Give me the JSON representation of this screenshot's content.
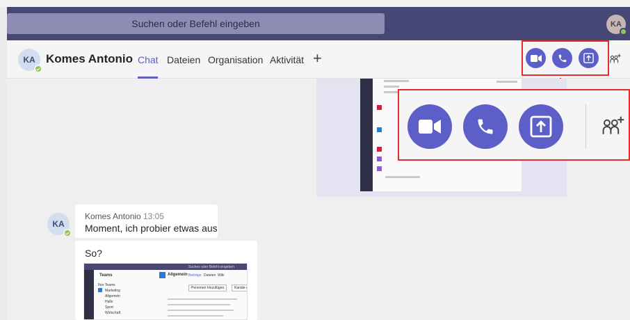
{
  "search": {
    "placeholder": "Suchen oder Befehl eingeben"
  },
  "me": {
    "initials": "KA"
  },
  "header": {
    "initials": "KA",
    "name": "Komes Antonio",
    "tabs": [
      {
        "label": "Chat"
      },
      {
        "label": "Dateien"
      },
      {
        "label": "Organisation"
      },
      {
        "label": "Aktivität"
      }
    ],
    "add_tab": "+"
  },
  "call_buttons": [
    {
      "icon": "video-call-icon"
    },
    {
      "icon": "audio-call-icon"
    },
    {
      "icon": "share-screen-icon"
    }
  ],
  "add_people_icon": "add-people-icon",
  "messages": [
    {
      "initials": "KA",
      "author": "Komes Antonio",
      "time": "13:05",
      "text": "Moment, ich probier etwas aus"
    },
    {
      "text": "So?"
    }
  ],
  "mini_screenshot": {
    "title": "Suchen oder Befehl eingeben",
    "teams_label": "Teams",
    "channel": "Allgemein",
    "tabs": [
      "Beiträge",
      "Dateien",
      "Wiki"
    ],
    "button1": "Personen hinzufügen",
    "button2": "Kanäle erst",
    "list": [
      "Ihre Teams",
      "Marketing",
      "Allgemein",
      "Hallo",
      "Sport",
      "Wirtschaft"
    ]
  },
  "colors": {
    "accent": "#5b5fc7",
    "titlebar": "#464775",
    "highlight": "#e52d2d",
    "presence": "#92c353"
  }
}
